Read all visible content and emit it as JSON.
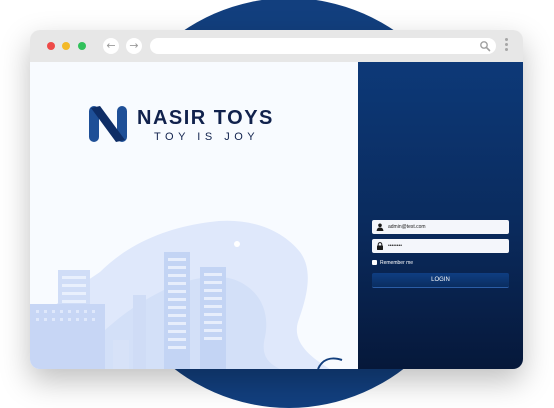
{
  "brand": {
    "name": "NASIR TOYS",
    "tagline": "TOY IS JOY"
  },
  "browser": {
    "back_glyph": "←",
    "forward_glyph": "→",
    "address_value": ""
  },
  "login": {
    "email_value": "admin@test.com",
    "password_value": "password",
    "remember_label": "Remember me",
    "login_label": "LOGIN"
  },
  "colors": {
    "primary": "#123f7e",
    "brand_text": "#11224d",
    "panel_dark": "#06183a"
  },
  "icons": [
    "search-icon",
    "user-icon",
    "lock-icon",
    "menu-icon"
  ]
}
